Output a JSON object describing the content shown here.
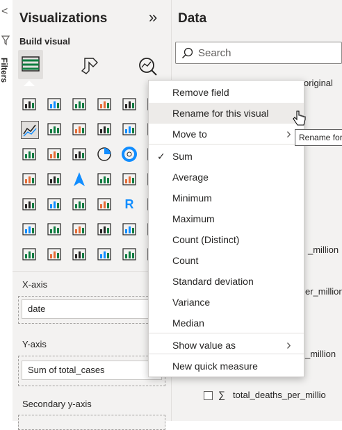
{
  "left_strip": {
    "collapse_glyph": "<",
    "filters_label": "Filters"
  },
  "visualizations": {
    "title": "Visualizations",
    "expand_glyph": "»",
    "build_visual_label": "Build visual",
    "gallery_row7_text": "R",
    "x_axis": {
      "label": "X-axis",
      "field": "date"
    },
    "y_axis": {
      "label": "Y-axis",
      "field": "Sum of total_cases"
    },
    "secondary_y_axis": {
      "label": "Secondary y-axis"
    }
  },
  "data_pane": {
    "title": "Data",
    "search_placeholder": "Search",
    "table_name_fragment": "original",
    "field_fragment_1": "_million",
    "field_fragment_2": "er_million",
    "field_fragment_3": "_million",
    "field_last": "total_deaths_per_millio",
    "sigma_glyph": "∑"
  },
  "context_menu": {
    "items": [
      {
        "label": "Remove field"
      },
      {
        "label": "Rename for this visual"
      },
      {
        "label": "Move to"
      },
      {
        "label": "Sum",
        "checked": true
      },
      {
        "label": "Average"
      },
      {
        "label": "Minimum"
      },
      {
        "label": "Maximum"
      },
      {
        "label": "Count (Distinct)"
      },
      {
        "label": "Count"
      },
      {
        "label": "Standard deviation"
      },
      {
        "label": "Variance"
      },
      {
        "label": "Median"
      },
      {
        "label": "Show value as"
      },
      {
        "label": "New quick measure"
      }
    ],
    "check_glyph": "✓",
    "submenu_glyph": "›"
  },
  "tooltip": {
    "text": "Rename for this visual"
  },
  "colors": {
    "accent": "#118dff",
    "pane": "#f3f2f1",
    "menu_hover": "#edebe9"
  }
}
